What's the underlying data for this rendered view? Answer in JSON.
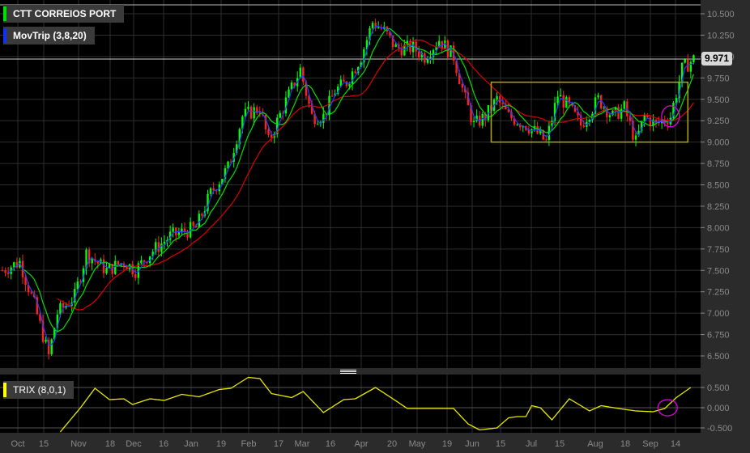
{
  "legends": {
    "symbol": {
      "label": "CTT CORREIOS PORT",
      "color": "#00e000"
    },
    "indicator": {
      "label": "MovTrip (3,8,20)",
      "color": "#1030ff"
    },
    "trix": {
      "label": "TRIX (8,0,1)",
      "color": "#ffff00"
    }
  },
  "last_price": "9.971",
  "colors": {
    "up": "#00ff00",
    "down": "#ff2020",
    "ma_fast": "#2040ff",
    "ma_mid": "#00e000",
    "ma_slow": "#e00000",
    "box": "#b0a800",
    "highlight": "#e000e0",
    "trix": "#e8e800"
  },
  "chart_data": [
    {
      "type": "candlestick",
      "title": "CTT CORREIOS PORT",
      "ylim": [
        6.4,
        10.6
      ],
      "y_ticks": [
        "10.500",
        "10.250",
        "10.000",
        "9.750",
        "9.500",
        "9.250",
        "9.000",
        "8.750",
        "8.500",
        "8.250",
        "8.000",
        "7.750",
        "7.500",
        "7.250",
        "7.000",
        "6.750",
        "6.500"
      ],
      "x_ticks": [
        "Oct",
        "15",
        "Nov",
        "18",
        "Dec",
        "16",
        "Jan",
        "19",
        "Feb",
        "17",
        "Mar",
        "16",
        "Apr",
        "20",
        "May",
        "19",
        "Jun",
        "15",
        "Jul",
        "15",
        "Aug",
        "18",
        "Sep",
        "14"
      ],
      "close_path": [
        [
          0,
          7.5
        ],
        [
          6,
          7.6
        ],
        [
          11,
          7.1
        ],
        [
          16,
          6.5
        ],
        [
          19,
          7.0
        ],
        [
          25,
          7.2
        ],
        [
          29,
          7.7
        ],
        [
          36,
          7.5
        ],
        [
          42,
          7.6
        ],
        [
          46,
          7.5
        ],
        [
          51,
          7.7
        ],
        [
          58,
          7.9
        ],
        [
          67,
          8.0
        ],
        [
          72,
          8.4
        ],
        [
          78,
          8.7
        ],
        [
          83,
          9.3
        ],
        [
          89,
          9.4
        ],
        [
          92,
          9.0
        ],
        [
          97,
          9.4
        ],
        [
          103,
          9.85
        ],
        [
          107,
          9.3
        ],
        [
          111,
          9.3
        ],
        [
          115,
          9.6
        ],
        [
          119,
          9.7
        ],
        [
          124,
          10.0
        ],
        [
          128,
          10.4
        ],
        [
          132,
          10.3
        ],
        [
          136,
          10.1
        ],
        [
          142,
          10.1
        ],
        [
          146,
          10.0
        ],
        [
          151,
          10.2
        ],
        [
          156,
          10.0
        ],
        [
          160,
          9.5
        ],
        [
          163,
          9.2
        ],
        [
          167,
          9.3
        ],
        [
          171,
          9.5
        ],
        [
          175,
          9.3
        ],
        [
          181,
          9.2
        ],
        [
          185,
          9.1
        ],
        [
          188,
          9.0
        ],
        [
          192,
          9.55
        ],
        [
          196,
          9.4
        ],
        [
          200,
          9.2
        ],
        [
          206,
          9.5
        ],
        [
          211,
          9.3
        ],
        [
          215,
          9.4
        ],
        [
          219,
          9.0
        ],
        [
          222,
          9.3
        ],
        [
          226,
          9.2
        ],
        [
          231,
          9.3
        ],
        [
          235,
          9.85
        ],
        [
          239,
          9.97
        ]
      ],
      "moving_averages": [
        3,
        8,
        20
      ],
      "annotations": {
        "box": {
          "price_low": 9.0,
          "price_high": 9.7,
          "day_start": 169,
          "day_end": 237
        },
        "circle": {
          "day": 231,
          "price": 9.3
        }
      }
    },
    {
      "type": "line",
      "title": "TRIX (8,0,1)",
      "ylim": [
        -0.6,
        0.8
      ],
      "y_ticks": [
        "0.500",
        "0.000",
        "-0.500"
      ],
      "points": [
        [
          20,
          -0.6
        ],
        [
          27,
          0.0
        ],
        [
          32,
          0.48
        ],
        [
          37,
          0.2
        ],
        [
          42,
          0.22
        ],
        [
          45,
          0.08
        ],
        [
          51,
          0.22
        ],
        [
          56,
          0.18
        ],
        [
          62,
          0.33
        ],
        [
          68,
          0.27
        ],
        [
          75,
          0.45
        ],
        [
          79,
          0.48
        ],
        [
          85,
          0.75
        ],
        [
          89,
          0.72
        ],
        [
          93,
          0.35
        ],
        [
          100,
          0.25
        ],
        [
          104,
          0.4
        ],
        [
          111,
          -0.12
        ],
        [
          118,
          0.2
        ],
        [
          122,
          0.22
        ],
        [
          129,
          0.5
        ],
        [
          135,
          0.22
        ],
        [
          140,
          -0.02
        ],
        [
          144,
          -0.02
        ],
        [
          156,
          -0.02
        ],
        [
          161,
          -0.4
        ],
        [
          165,
          -0.55
        ],
        [
          171,
          -0.5
        ],
        [
          175,
          -0.25
        ],
        [
          178,
          -0.22
        ],
        [
          181,
          -0.22
        ],
        [
          183,
          0.05
        ],
        [
          186,
          0.0
        ],
        [
          190,
          -0.3
        ],
        [
          196,
          0.22
        ],
        [
          200,
          0.05
        ],
        [
          203,
          -0.08
        ],
        [
          207,
          0.05
        ],
        [
          214,
          -0.03
        ],
        [
          219,
          -0.08
        ],
        [
          225,
          -0.1
        ],
        [
          229,
          -0.02
        ],
        [
          233,
          0.25
        ],
        [
          238,
          0.5
        ]
      ],
      "circle": {
        "day": 230,
        "value": 0.0
      }
    }
  ]
}
